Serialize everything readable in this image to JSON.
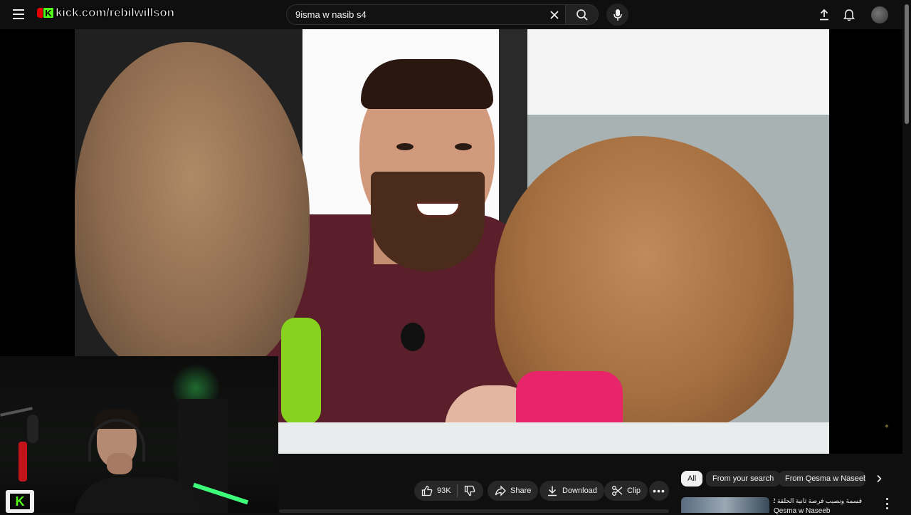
{
  "overlay": {
    "kick_badge": "K",
    "kick_handle": "kick.com/rebilwillson"
  },
  "search": {
    "value": "9isma w nasib s4",
    "placeholder": "Search"
  },
  "icons": {
    "menu": "hamburger-icon",
    "clear": "close-icon",
    "search": "search-icon",
    "mic": "microphone-icon",
    "upload": "upload-icon",
    "notifications": "bell-icon",
    "like": "thumbs-up-icon",
    "dislike": "thumbs-down-icon",
    "share": "share-icon",
    "download": "download-icon",
    "clip": "scissors-icon",
    "more": "more-horizontal-icon",
    "chevron": "chevron-right-icon"
  },
  "actions": {
    "like_count": "93K",
    "share_label": "Share",
    "download_label": "Download",
    "clip_label": "Clip",
    "more_label": "•••"
  },
  "webcam": {
    "logo_letter": "K"
  },
  "chips": [
    {
      "label": "All",
      "active": true
    },
    {
      "label": "From your search",
      "active": false
    },
    {
      "label": "From Qesma w Naseeb",
      "active": false
    }
  ],
  "recommendation": {
    "title": "قسمة ونصيب فرصة ثانية الحلقة 2 -",
    "channel": "Qesma w Naseeb"
  },
  "colors": {
    "background": "#0f0f0f",
    "chip_active": "#f1f1f1",
    "button_bg": "#272727",
    "kick_green": "#53fc18"
  }
}
